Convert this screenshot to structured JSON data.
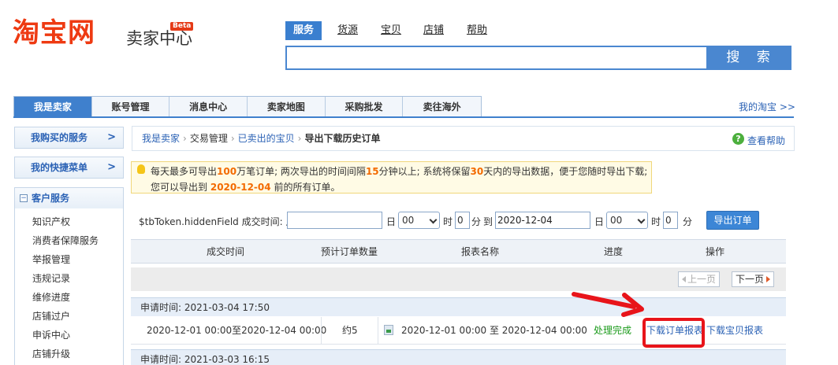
{
  "header": {
    "logo": "淘宝网",
    "logo_sub": "卖家中心",
    "beta": "Beta",
    "search_tabs": [
      "服务",
      "货源",
      "宝贝",
      "店铺",
      "帮助"
    ],
    "search_value": "",
    "search_button": "搜 索"
  },
  "nav": {
    "items": [
      "我是卖家",
      "账号管理",
      "消息中心",
      "卖家地图",
      "采购批发",
      "卖往海外"
    ],
    "my_taobao": "我的淘宝 >>"
  },
  "sidebar": {
    "bought_services": "我购买的服务",
    "quick_menu": "我的快捷菜单",
    "arrow": ">",
    "customer_service": {
      "title": "客户服务",
      "toggle": "−",
      "items": [
        "知识产权",
        "消费者保障服务",
        "举报管理",
        "违规记录",
        "维修进度",
        "店铺过户",
        "申诉中心",
        "店铺升级"
      ]
    }
  },
  "breadcrumb": {
    "items": [
      "我是卖家",
      "交易管理",
      "已卖出的宝贝"
    ],
    "separator": "›",
    "current": "导出下载历史订单",
    "help_icon": "?",
    "help": "查看帮助"
  },
  "notice": {
    "line1_a": "每天最多可导出",
    "line1_b": "100",
    "line1_c": "万笔订单; 两次导出的时间间隔",
    "line1_d": "15",
    "line1_e": "分钟以上; 系统将保留",
    "line1_f": "30",
    "line1_g": "天内的导出数据，便于您随时导出下载;",
    "line2_a": "您可以导出到",
    "line2_b": "2020-12-04",
    "line2_c": "前的所有订单。"
  },
  "filter": {
    "label": "$tbToken.hiddenField 成交时间: 从",
    "from_date": "",
    "day_label": "日",
    "hour_select": "00",
    "hour_label": "时",
    "minute_value": "0",
    "minute_label": "分",
    "to_label": "到",
    "to_date": "2020-12-04",
    "to_day_label": "日",
    "to_hour_select": "00",
    "to_hour_label": "时",
    "to_minute_value": "0",
    "to_minute_label": "分",
    "export_button": "导出订单"
  },
  "table": {
    "headers": [
      "成交时间",
      "预计订单数量",
      "报表名称",
      "进度",
      "操作"
    ],
    "prev_page": "上一页",
    "next_page": "下一页",
    "groups": [
      {
        "apply_time": "申请时间: 2021-03-04 17:50",
        "deal_time": "2020-12-01 00:00至2020-12-04 00:00",
        "count": "约5",
        "report_name": "2020-12-01 00:00 至 2020-12-04 00:00",
        "status": "处理完成",
        "download_orders": "下载订单报表",
        "download_items": "下载宝贝报表"
      },
      {
        "apply_time": "申请时间: 2021-03-03 16:15"
      }
    ]
  },
  "colors": {
    "brand": "#ee3a12",
    "primary_blue": "#3f80cd",
    "link": "#2b62b5",
    "highlight": "#f36a00",
    "success": "#1a9a1a",
    "annotation_red": "#e8141a"
  }
}
